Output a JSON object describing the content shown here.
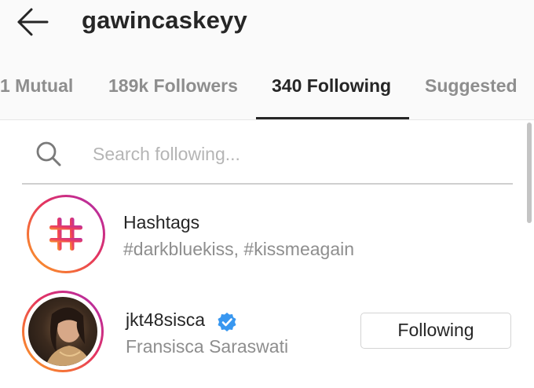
{
  "header": {
    "username": "gawincaskeyy",
    "back_icon": "arrow-left-icon"
  },
  "tabs": [
    {
      "label": "1 Mutual",
      "active": false
    },
    {
      "label": "189k Followers",
      "active": false
    },
    {
      "label": "340 Following",
      "active": true
    },
    {
      "label": "Suggested",
      "active": false
    }
  ],
  "search": {
    "placeholder": "Search following...",
    "value": "",
    "icon": "search-icon"
  },
  "list": {
    "hashtags": {
      "title": "Hashtags",
      "subtitle": "#darkbluekiss, #kissmeagain",
      "icon": "hashtag-icon"
    },
    "user": {
      "username": "jkt48sisca",
      "full_name": "Fransisca Saraswati",
      "verified": true,
      "button_label": "Following"
    }
  },
  "colors": {
    "text_primary": "#262626",
    "text_secondary": "#8e8e8e",
    "header_bg": "#fafafa",
    "verified": "#3897f0",
    "story_ring_start": "#f9a02b",
    "story_ring_end": "#a638b2"
  }
}
